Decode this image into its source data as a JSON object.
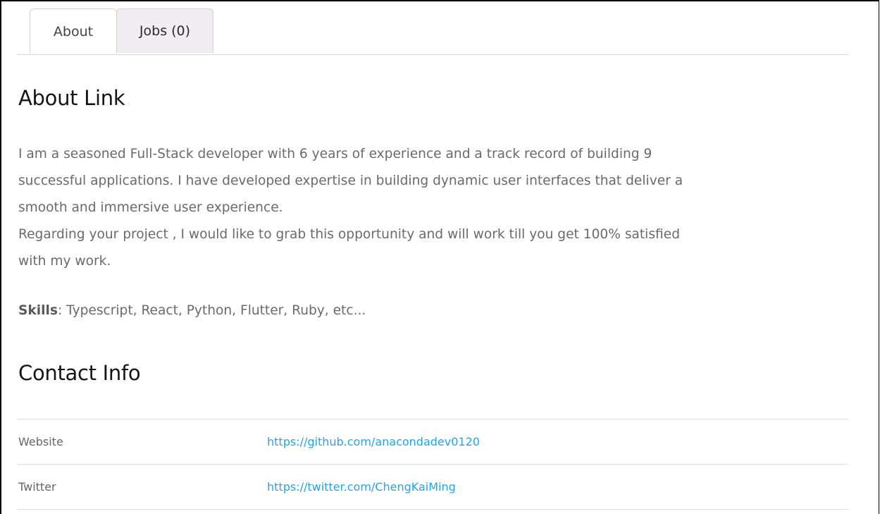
{
  "tabs": [
    {
      "label": "About",
      "active": true
    },
    {
      "label": "Jobs (0)",
      "active": false
    }
  ],
  "about": {
    "title": "About Link",
    "bio_lines": [
      "I am a seasoned Full-Stack developer with 6 years of experience and a track record of building 9",
      "successful applications. I have developed expertise in building dynamic user interfaces that deliver a",
      "smooth and immersive user experience.",
      "Regarding your project , I would like to grab this opportunity and will work till you get 100% satisfied",
      "with my work."
    ],
    "skills_label": "Skills",
    "skills_value": ": Typescript, React, Python, Flutter, Ruby, etc..."
  },
  "contact": {
    "title": "Contact Info",
    "rows": [
      {
        "label": "Website",
        "value": "https://github.com/anacondadev0120"
      },
      {
        "label": "Twitter",
        "value": "https://twitter.com/ChengKaiMing"
      }
    ]
  },
  "colors": {
    "link": "#1ea7e8",
    "body_text": "#6a6a6a",
    "heading": "#151515",
    "inactive_tab_bg": "#efedf1"
  }
}
